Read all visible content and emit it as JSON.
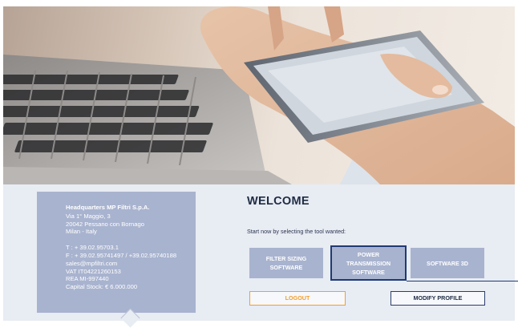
{
  "address": {
    "company": "Headquarters MP Filtri S.p.A.",
    "street": "Via 1° Maggio, 3",
    "city": "20042 Pessano con Bornago",
    "region": "Milan - Italy",
    "phone": "T : + 39.02.95703.1",
    "fax": "F : + 39.02.95741497 / +39.02.95740188",
    "email": "sales@mpfiltri.com",
    "vat": "VAT IT04221260153",
    "rea": "REA MI-997440",
    "capital": "Capital Stock: € 6.000.000"
  },
  "welcome": {
    "title": "WELCOME",
    "subtitle": "Start now by selecting the tool wanted:"
  },
  "tools": {
    "filter_sizing": "FILTER SIZING\nSOFTWARE",
    "power_transmission": "POWER\nTRANSMISSION\nSOFTWARE",
    "software_3d": "SOFTWARE 3D"
  },
  "actions": {
    "logout": "LOGOUT",
    "modify_profile": "MODIFY PROFILE"
  },
  "colors": {
    "card": "#a8b3cf",
    "panel": "#e8ecf3",
    "accent_orange": "#f0a030",
    "navy": "#1f3a73"
  }
}
